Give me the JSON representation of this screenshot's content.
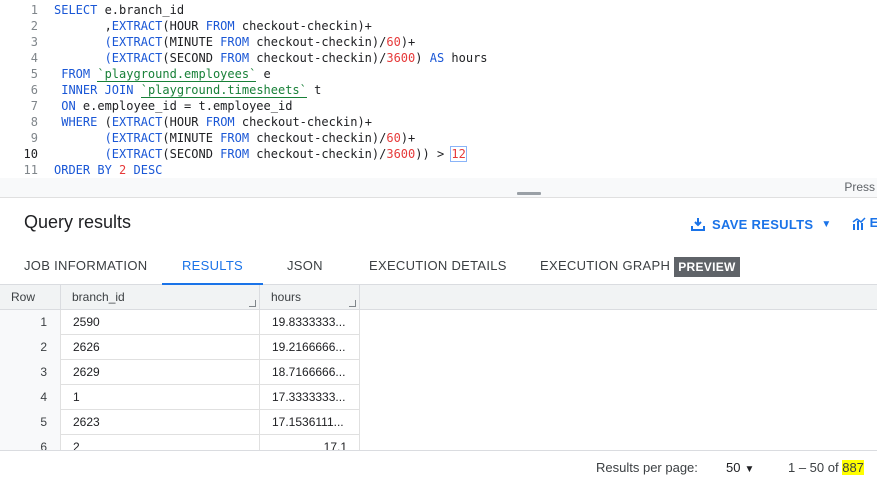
{
  "editor": {
    "line_numbers": [
      "1",
      "2",
      "3",
      "4",
      "5",
      "6",
      "7",
      "8",
      "9",
      "10",
      "11"
    ],
    "lines": [
      [
        {
          "t": "SELECT",
          "c": "kw"
        },
        {
          "t": " e.branch_id",
          "c": ""
        }
      ],
      [
        {
          "t": "       ,",
          "c": ""
        },
        {
          "t": "EXTRACT",
          "c": "fn"
        },
        {
          "t": "(HOUR ",
          "c": ""
        },
        {
          "t": "FROM",
          "c": "kw"
        },
        {
          "t": " checkout-checkin)+",
          "c": ""
        }
      ],
      [
        {
          "t": "       ",
          "c": ""
        },
        {
          "t": "(EXTRACT",
          "c": "fn"
        },
        {
          "t": "(MINUTE ",
          "c": ""
        },
        {
          "t": "FROM",
          "c": "kw"
        },
        {
          "t": " checkout-checkin)/",
          "c": ""
        },
        {
          "t": "60",
          "c": "num"
        },
        {
          "t": ")+",
          "c": ""
        }
      ],
      [
        {
          "t": "       ",
          "c": ""
        },
        {
          "t": "(EXTRACT",
          "c": "fn"
        },
        {
          "t": "(SECOND ",
          "c": ""
        },
        {
          "t": "FROM",
          "c": "kw"
        },
        {
          "t": " checkout-checkin)/",
          "c": ""
        },
        {
          "t": "3600",
          "c": "num"
        },
        {
          "t": ") ",
          "c": ""
        },
        {
          "t": "AS",
          "c": "kw"
        },
        {
          "t": " hours",
          "c": ""
        }
      ],
      [
        {
          "t": " FROM",
          "c": "kw"
        },
        {
          "t": " ",
          "c": ""
        },
        {
          "t": "`playground.employees`",
          "c": "tbl"
        },
        {
          "t": " e",
          "c": ""
        }
      ],
      [
        {
          "t": " INNER JOIN",
          "c": "kw"
        },
        {
          "t": " ",
          "c": ""
        },
        {
          "t": "`playground.timesheets`",
          "c": "tbl"
        },
        {
          "t": " t",
          "c": ""
        }
      ],
      [
        {
          "t": " ON",
          "c": "kw"
        },
        {
          "t": " e.employee_id = t.employee_id",
          "c": ""
        }
      ],
      [
        {
          "t": " WHERE",
          "c": "kw"
        },
        {
          "t": " (",
          "c": ""
        },
        {
          "t": "EXTRACT",
          "c": "fn"
        },
        {
          "t": "(HOUR ",
          "c": ""
        },
        {
          "t": "FROM",
          "c": "kw"
        },
        {
          "t": " checkout-checkin)+",
          "c": ""
        }
      ],
      [
        {
          "t": "       ",
          "c": ""
        },
        {
          "t": "(EXTRACT",
          "c": "fn"
        },
        {
          "t": "(MINUTE ",
          "c": ""
        },
        {
          "t": "FROM",
          "c": "kw"
        },
        {
          "t": " checkout-checkin)/",
          "c": ""
        },
        {
          "t": "60",
          "c": "num"
        },
        {
          "t": ")+",
          "c": ""
        }
      ],
      [
        {
          "t": "       ",
          "c": ""
        },
        {
          "t": "(EXTRACT",
          "c": "fn"
        },
        {
          "t": "(SECOND ",
          "c": ""
        },
        {
          "t": "FROM",
          "c": "kw"
        },
        {
          "t": " checkout-checkin)/",
          "c": ""
        },
        {
          "t": "3600",
          "c": "num"
        },
        {
          "t": ")) > ",
          "c": ""
        },
        {
          "t": "12",
          "c": "num cursor-box"
        }
      ],
      [
        {
          "t": "ORDER BY",
          "c": "kw"
        },
        {
          "t": " ",
          "c": ""
        },
        {
          "t": "2",
          "c": "num"
        },
        {
          "t": " ",
          "c": ""
        },
        {
          "t": "DESC",
          "c": "kw"
        }
      ]
    ],
    "active_line_index": 9,
    "press_hint": "Press"
  },
  "results": {
    "title": "Query results",
    "save_label": "SAVE RESULTS",
    "save_caret": "▼",
    "explore_label": "E",
    "tabs": [
      {
        "label": "JOB INFORMATION",
        "active": false
      },
      {
        "label": "RESULTS",
        "active": true
      },
      {
        "label": "JSON",
        "active": false
      },
      {
        "label": "EXECUTION DETAILS",
        "active": false
      },
      {
        "label": "EXECUTION GRAPH",
        "active": false
      }
    ],
    "preview_badge": "PREVIEW",
    "columns": [
      "Row",
      "branch_id",
      "hours"
    ],
    "rows": [
      {
        "row": "1",
        "branch_id": "2590",
        "hours": "19.8333333..."
      },
      {
        "row": "2",
        "branch_id": "2626",
        "hours": "19.2166666..."
      },
      {
        "row": "3",
        "branch_id": "2629",
        "hours": "18.7166666..."
      },
      {
        "row": "4",
        "branch_id": "1",
        "hours": "17.3333333..."
      },
      {
        "row": "5",
        "branch_id": "2623",
        "hours": "17.1536111..."
      },
      {
        "row": "6",
        "branch_id": "2",
        "hours": "17.1"
      }
    ]
  },
  "footer": {
    "rpp_label": "Results per page:",
    "rpp_value": "50",
    "rpp_caret": "▼",
    "range_prefix": "1 – 50 of ",
    "total": "887"
  },
  "colors": {
    "accent": "#1a73e8",
    "keyword": "#1a57d6",
    "number": "#e63a3a",
    "table_ref": "#188038",
    "highlight": "#ffff00"
  },
  "icons": [
    "download-icon",
    "chevron-down-icon",
    "explore-chart-icon",
    "column-resize-icon"
  ]
}
